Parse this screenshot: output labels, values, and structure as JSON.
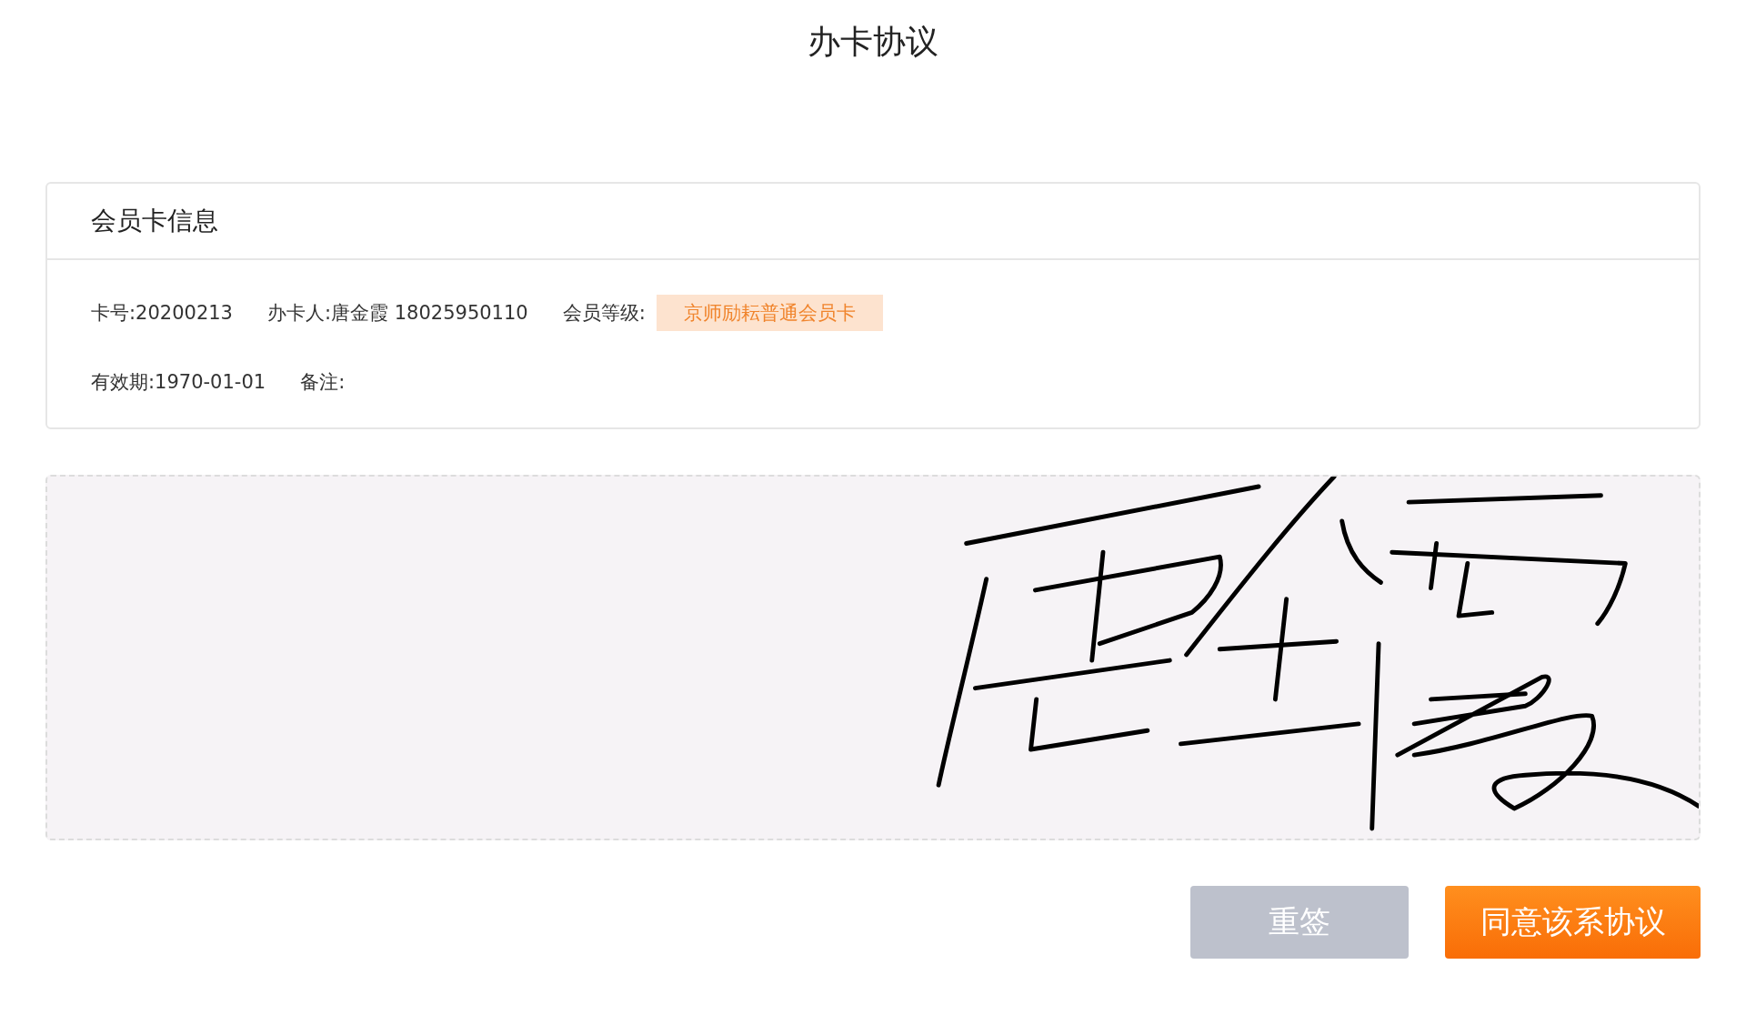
{
  "page": {
    "title": "办卡协议"
  },
  "card": {
    "title": "会员卡信息",
    "fields": [
      {
        "label": "卡号:20200213",
        "kind": "text"
      },
      {
        "label": "办卡人:唐金霞 18025950110",
        "kind": "text"
      },
      {
        "label": "会员等级:",
        "value": "京师励耘普通会员卡",
        "kind": "badge"
      },
      {
        "label": "有效期:1970-01-01",
        "kind": "text"
      },
      {
        "label": "备注:",
        "kind": "text"
      }
    ]
  },
  "signature": {
    "signed": true
  },
  "buttons": [
    {
      "label": "重签",
      "kind": "secondary"
    },
    {
      "label": "同意该系协议",
      "kind": "primary"
    }
  ]
}
